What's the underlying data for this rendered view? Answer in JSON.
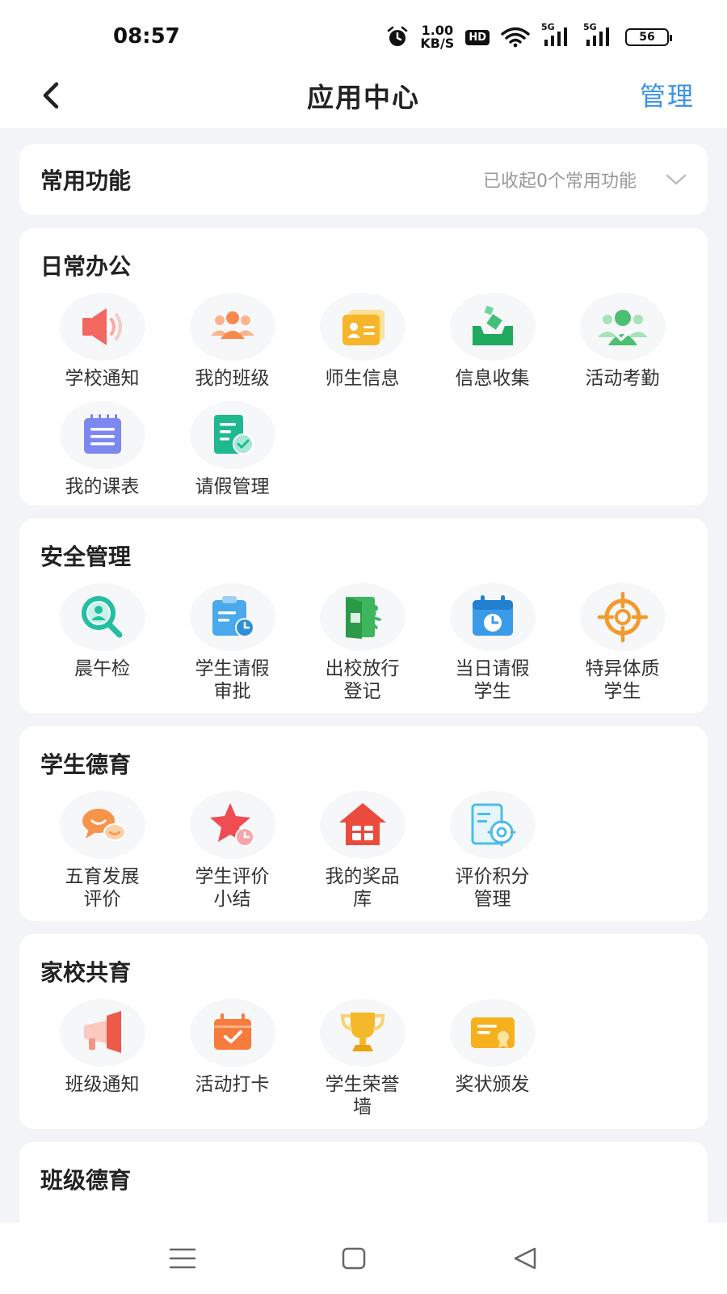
{
  "status": {
    "time": "08:57",
    "speed_value": "1.00",
    "speed_unit": "KB/S",
    "hd": "HD",
    "net1": "5G",
    "net2": "5G",
    "battery": "56"
  },
  "header": {
    "title": "应用中心",
    "manage_label": "管理"
  },
  "favorites": {
    "title": "常用功能",
    "hint": "已收起0个常用功能"
  },
  "sections": [
    {
      "title": "日常办公",
      "apps": [
        {
          "label": "学校通知",
          "icon": "speaker-icon"
        },
        {
          "label": "我的班级",
          "icon": "group-icon"
        },
        {
          "label": "师生信息",
          "icon": "id-card-icon"
        },
        {
          "label": "信息收集",
          "icon": "collect-box-icon"
        },
        {
          "label": "活动考勤",
          "icon": "attendance-icon"
        },
        {
          "label": "我的课表",
          "icon": "timetable-icon"
        },
        {
          "label": "请假管理",
          "icon": "leave-doc-icon"
        }
      ]
    },
    {
      "title": "安全管理",
      "apps": [
        {
          "label": "晨午检",
          "icon": "magnifier-user-icon"
        },
        {
          "label": "学生请假\n审批",
          "icon": "clipboard-clock-icon"
        },
        {
          "label": "出校放行\n登记",
          "icon": "school-exit-icon"
        },
        {
          "label": "当日请假\n学生",
          "icon": "calendar-clock-icon"
        },
        {
          "label": "特异体质\n学生",
          "icon": "target-icon"
        }
      ]
    },
    {
      "title": "学生德育",
      "apps": [
        {
          "label": "五育发展\n评价",
          "icon": "chat-bubbles-icon"
        },
        {
          "label": "学生评价\n小结",
          "icon": "star-clock-icon"
        },
        {
          "label": "我的奖品\n库",
          "icon": "gift-house-icon"
        },
        {
          "label": "评价积分\n管理",
          "icon": "gear-doc-icon"
        }
      ]
    },
    {
      "title": "家校共育",
      "apps": [
        {
          "label": "班级通知",
          "icon": "megaphone-icon"
        },
        {
          "label": "活动打卡",
          "icon": "calendar-check-icon"
        },
        {
          "label": "学生荣誉\n墙",
          "icon": "trophy-icon"
        },
        {
          "label": "奖状颁发",
          "icon": "certificate-icon"
        }
      ]
    },
    {
      "title": "班级德育",
      "apps": []
    }
  ]
}
